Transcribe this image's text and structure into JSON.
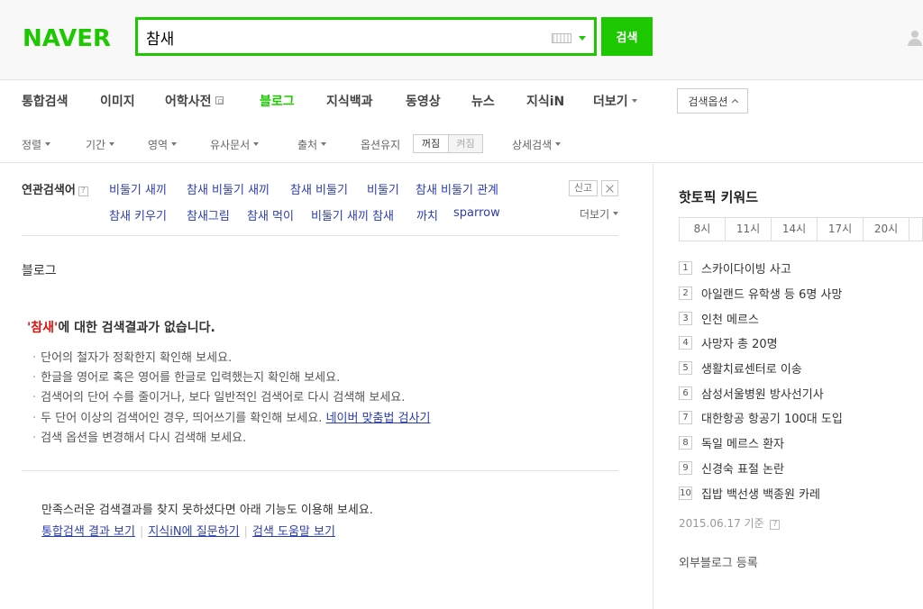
{
  "header": {
    "logo": "NAVER",
    "search_value": "참새",
    "search_button": "검색"
  },
  "tabs": [
    {
      "label": "통합검색"
    },
    {
      "label": "이미지"
    },
    {
      "label": "어학사전"
    },
    {
      "label": "블로그"
    },
    {
      "label": "지식백과"
    },
    {
      "label": "동영상"
    },
    {
      "label": "뉴스"
    },
    {
      "label": "지식iN"
    },
    {
      "label": "더보기"
    }
  ],
  "search_options_label": "검색옵션",
  "filters": {
    "sort": "정렬",
    "period": "기간",
    "area": "영역",
    "similar": "유사문서",
    "source": "출처",
    "keep_options": "옵션유지",
    "on": "꺼짐",
    "off": "켜짐",
    "detail": "상세검색"
  },
  "related": {
    "title": "연관검색어",
    "help": "?",
    "keywords": [
      "비둘기 새끼",
      "참새 비둘기 새끼",
      "참새 비둘기",
      "비둘기",
      "참새 비둘기 관계",
      "참새 키우기",
      "참새그림",
      "참새 먹이",
      "비둘기 새끼 참새",
      "까치",
      "sparrow"
    ],
    "report": "신고",
    "more": "더보기"
  },
  "main": {
    "section_title": "블로그",
    "no_result_keyword": "'참새'",
    "no_result_text": "에 대한 검색결과가 없습니다.",
    "tips": [
      "단어의 철자가 정확한지 확인해 보세요.",
      "한글을 영어로 혹은 영어를 한글로 입력했는지 확인해 보세요.",
      "검색어의 단어 수를 줄이거나, 보다 일반적인 검색어로 다시 검색해 보세요.",
      "두 단어 이상의 검색어인 경우, 띄어쓰기를 확인해 보세요.",
      "검색 옵션을 변경해서 다시 검색해 보세요."
    ],
    "spell_checker_link": "네이버 맞춤법 검사기",
    "alt_title": "만족스러운 검색결과를 찾지 못하셨다면 아래 기능도 이용해 보세요.",
    "alt_links": [
      "통합검색 결과 보기",
      "지식iN에 질문하기",
      "검색 도움말 보기"
    ]
  },
  "sidebar": {
    "title": "핫토픽 키워드",
    "time_tabs": [
      "8시",
      "11시",
      "14시",
      "17시",
      "20시"
    ],
    "keywords": [
      "스카이다이빙 사고",
      "아일랜드 유학생 등 6명 사망",
      "인천 메르스",
      "사망자 총 20명",
      "생활치료센터로 이송",
      "삼성서울병원 방사선기사",
      "대한항공 항공기 100대 도입",
      "독일 메르스 환자",
      "신경숙 표절 논란",
      "집밥 백선생 백종원 카레"
    ],
    "date": "2015.06.17 기준",
    "blog_register": "외부블로그 등록"
  }
}
